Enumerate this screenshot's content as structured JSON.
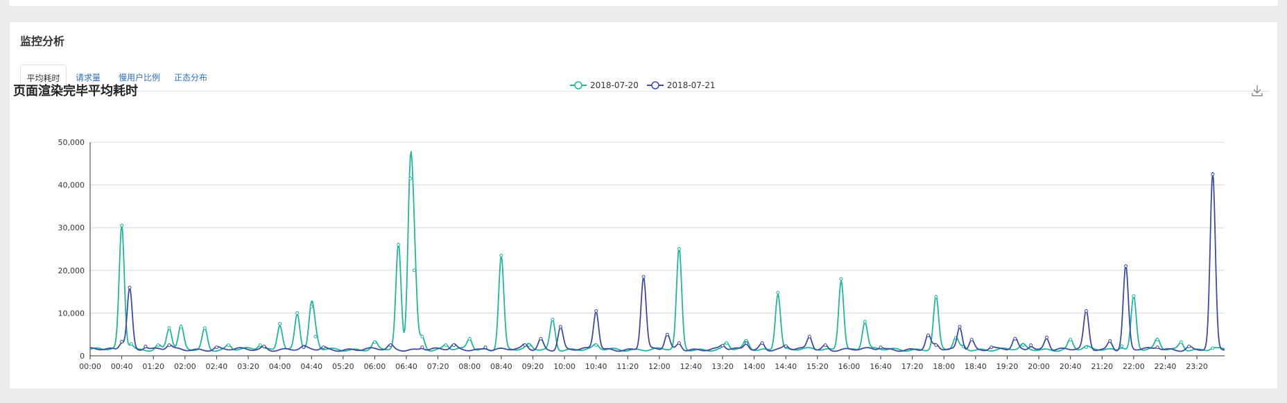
{
  "panel": {
    "title": "监控分析",
    "tabs": [
      {
        "label": "平均耗时",
        "active": true
      },
      {
        "label": "请求量",
        "active": false
      },
      {
        "label": "慢用户比例",
        "active": false
      },
      {
        "label": "正态分布",
        "active": false
      }
    ]
  },
  "colors": {
    "series1": "#1fb59a",
    "series2": "#3e4a9a",
    "grid": "#d9d9d9",
    "axis": "#333333"
  },
  "icons": {
    "download": "download-icon"
  },
  "chart_data": {
    "type": "line",
    "title": "页面渲染完毕平均耗时",
    "ylim": [
      0,
      50000
    ],
    "yticks": [
      "0",
      "10,000",
      "20,000",
      "30,000",
      "40,000",
      "50,000"
    ],
    "xticks": [
      "00:00",
      "00:40",
      "01:20",
      "02:00",
      "02:40",
      "03:20",
      "04:00",
      "04:40",
      "05:20",
      "06:00",
      "06:40",
      "07:20",
      "08:00",
      "08:40",
      "09:20",
      "10:00",
      "10:40",
      "11:20",
      "12:00",
      "12:40",
      "13:20",
      "14:00",
      "14:40",
      "15:20",
      "16:00",
      "16:40",
      "17:20",
      "18:00",
      "18:40",
      "19:20",
      "20:00",
      "20:40",
      "21:20",
      "22:00",
      "22:40",
      "23:20"
    ],
    "x_range_minutes": [
      0,
      1435
    ],
    "baseline": 1500,
    "legend_position": "top-center",
    "grid": true,
    "series": [
      {
        "name": "2018-07-20",
        "peaks": [
          [
            40,
            30500
          ],
          [
            52,
            2800
          ],
          [
            86,
            2500
          ],
          [
            100,
            6500
          ],
          [
            115,
            6800
          ],
          [
            145,
            6500
          ],
          [
            175,
            2500
          ],
          [
            215,
            2500
          ],
          [
            240,
            7500
          ],
          [
            262,
            10000
          ],
          [
            280,
            11500
          ],
          [
            285,
            4500
          ],
          [
            360,
            3200
          ],
          [
            390,
            26000
          ],
          [
            405,
            41500
          ],
          [
            410,
            20000
          ],
          [
            420,
            4500
          ],
          [
            450,
            2500
          ],
          [
            480,
            4000
          ],
          [
            520,
            23500
          ],
          [
            555,
            2500
          ],
          [
            585,
            8500
          ],
          [
            640,
            2500
          ],
          [
            745,
            25000
          ],
          [
            805,
            3000
          ],
          [
            830,
            3500
          ],
          [
            870,
            14800
          ],
          [
            950,
            18000
          ],
          [
            980,
            8000
          ],
          [
            1070,
            13800
          ],
          [
            1095,
            4200
          ],
          [
            1105,
            2200
          ],
          [
            1180,
            2500
          ],
          [
            1240,
            3800
          ],
          [
            1260,
            2000
          ],
          [
            1305,
            2300
          ],
          [
            1320,
            14000
          ],
          [
            1350,
            3800
          ],
          [
            1380,
            3200
          ],
          [
            1420,
            1800
          ]
        ]
      },
      {
        "name": "2018-07-21",
        "peaks": [
          [
            40,
            3300
          ],
          [
            50,
            16000
          ],
          [
            70,
            2200
          ],
          [
            100,
            2500
          ],
          [
            160,
            2000
          ],
          [
            220,
            2200
          ],
          [
            270,
            2000
          ],
          [
            295,
            2000
          ],
          [
            380,
            2500
          ],
          [
            420,
            2000
          ],
          [
            460,
            2500
          ],
          [
            500,
            2000
          ],
          [
            550,
            2500
          ],
          [
            570,
            4000
          ],
          [
            595,
            6800
          ],
          [
            640,
            10500
          ],
          [
            700,
            18500
          ],
          [
            730,
            5000
          ],
          [
            745,
            3000
          ],
          [
            800,
            2400
          ],
          [
            830,
            3000
          ],
          [
            850,
            3000
          ],
          [
            880,
            2300
          ],
          [
            910,
            4500
          ],
          [
            930,
            2500
          ],
          [
            1000,
            2000
          ],
          [
            1060,
            4800
          ],
          [
            1070,
            2500
          ],
          [
            1100,
            6800
          ],
          [
            1115,
            3800
          ],
          [
            1140,
            2000
          ],
          [
            1170,
            4000
          ],
          [
            1190,
            2500
          ],
          [
            1210,
            4300
          ],
          [
            1260,
            10500
          ],
          [
            1290,
            3500
          ],
          [
            1310,
            21000
          ],
          [
            1350,
            2000
          ],
          [
            1390,
            2200
          ],
          [
            1420,
            42500
          ]
        ]
      }
    ]
  }
}
